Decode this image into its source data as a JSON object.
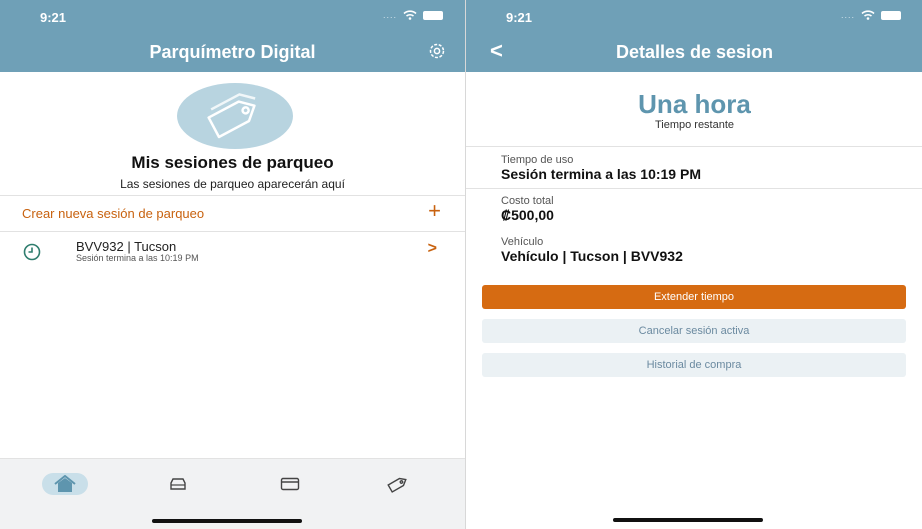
{
  "left": {
    "status": {
      "time": "9:21"
    },
    "header": {
      "title": "Parquímetro Digital",
      "settings_icon": "gear-icon"
    },
    "empty_state": {
      "title": "Mis sesiones de parqueo",
      "subtitle": "Las sesiones de parqueo aparecerán aquí"
    },
    "create": {
      "label": "Crear nueva sesión de parqueo",
      "icon": "+"
    },
    "sessions": [
      {
        "title": "BVV932 | Tucson",
        "subtitle": "Sesión termina a las 10:19 PM"
      }
    ],
    "tabs": [
      {
        "name": "home",
        "active": true
      },
      {
        "name": "car",
        "active": false
      },
      {
        "name": "card",
        "active": false
      },
      {
        "name": "tag",
        "active": false
      }
    ]
  },
  "right": {
    "status": {
      "time": "9:21"
    },
    "header": {
      "title": "Detalles de sesion",
      "back": "<"
    },
    "remaining": {
      "value": "Una hora",
      "label": "Tiempo restante"
    },
    "fields": {
      "usage": {
        "label": "Tiempo de uso",
        "value": "Sesión termina a las 10:19 PM"
      },
      "cost": {
        "label": "Costo total",
        "value": "₡500,00"
      },
      "vehicle": {
        "label": "Vehículo",
        "value": "Vehículo | Tucson | BVV932"
      }
    },
    "buttons": {
      "extend": "Extender tiempo",
      "cancel": "Cancelar sesión activa",
      "history": "Historial de compra"
    }
  },
  "colors": {
    "header": "#6fa0b7",
    "accent": "#c8620f",
    "primary_button": "#d66b12",
    "big_text": "#5e95ae"
  }
}
